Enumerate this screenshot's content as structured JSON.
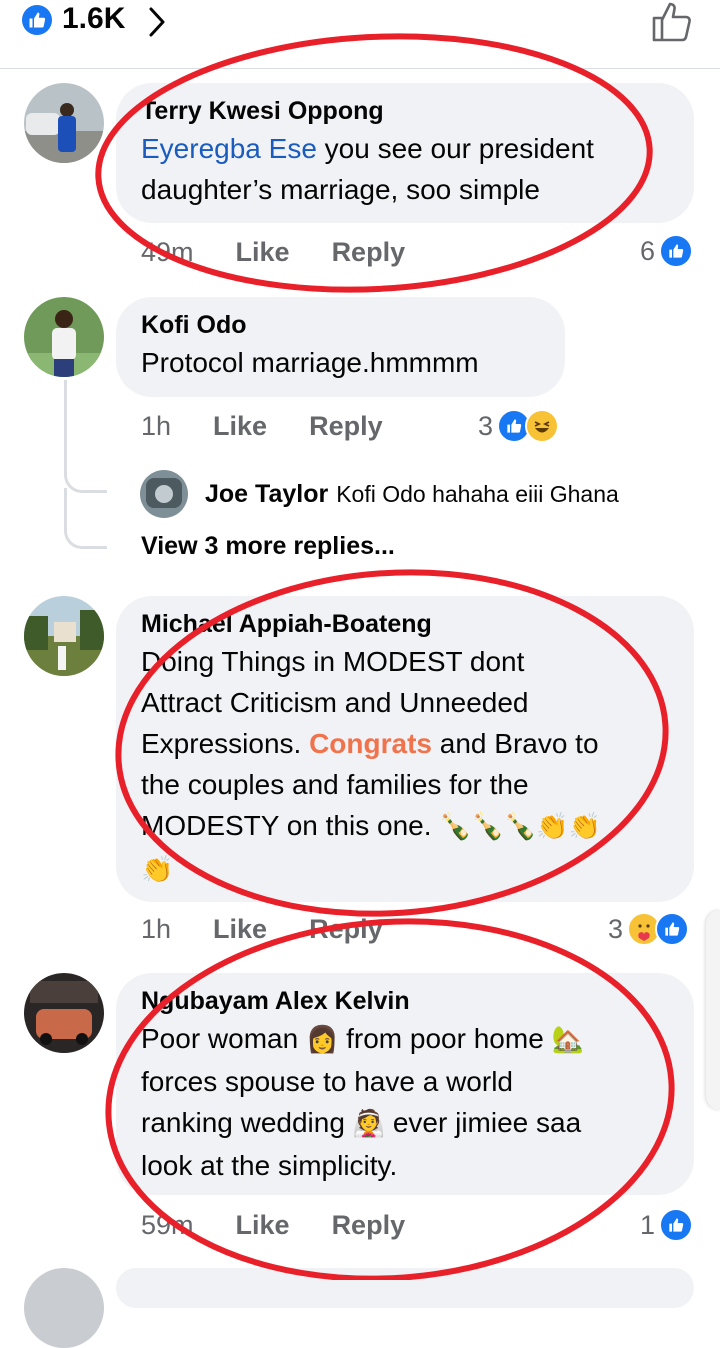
{
  "header": {
    "reaction_count": "1.6K"
  },
  "comments": [
    {
      "author": "Terry Kwesi Oppong",
      "mention": "Eyeregba Ese",
      "text_line1": "you see our president",
      "text_line2": "daughter’s marriage, soo simple",
      "time": "49m",
      "like_label": "Like",
      "reply_label": "Reply",
      "reaction_count": "6"
    },
    {
      "author": "Kofi Odo",
      "text": "Protocol marriage.hmmmm",
      "time": "1h",
      "like_label": "Like",
      "reply_label": "Reply",
      "reaction_count": "3",
      "reply": {
        "author": "Joe Taylor",
        "text": "Kofi Odo hahaha eiii Ghana"
      },
      "view_more": "View 3 more replies..."
    },
    {
      "author": "Michael Appiah-Boateng",
      "text_line1": "Doing Things in MODEST dont",
      "text_line2": "Attract Criticism  and Unneeded",
      "text_line3a": "Expressions.",
      "highlight": "Congrats",
      "text_line3b": "and Bravo to",
      "text_line4": "the couples and families for the",
      "text_line5": "MODESTY on this one.",
      "emoji_line5": "🍾🍾🍾👏👏",
      "emoji_line6": "👏",
      "time": "1h",
      "like_label": "Like",
      "reply_label": "Reply",
      "reaction_count": "3"
    },
    {
      "author": "Ngubayam Alex Kelvin",
      "text_line1a": "Poor woman",
      "emoji1": "👩",
      "text_line1b": "from poor home",
      "emoji2": "🏡",
      "text_line2": "forces spouse to have a world",
      "text_line3a": "ranking wedding",
      "emoji3": "👰",
      "text_line3b": "ever jimiee saa",
      "text_line4": "look at the simplicity.",
      "time": "59m",
      "like_label": "Like",
      "reply_label": "Reply",
      "reaction_count": "1"
    }
  ],
  "colors": {
    "accent": "#1877f2",
    "mention": "#1a5bbf",
    "highlight": "#f0734c",
    "annotation": "#e8202a",
    "bubble": "#f0f2f5"
  },
  "icons": [
    "like-icon",
    "chevron-right-icon",
    "thumbs-up-outline-icon",
    "haha-icon",
    "care-icon"
  ]
}
